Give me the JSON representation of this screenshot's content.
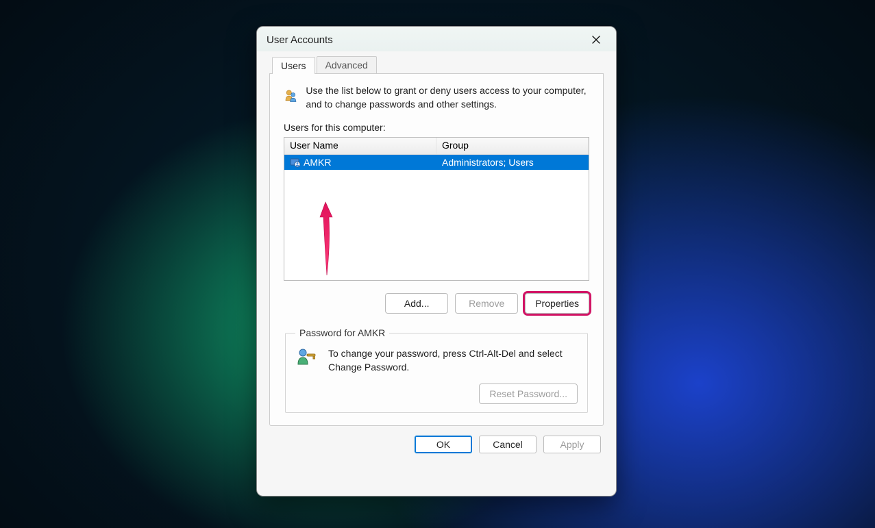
{
  "window": {
    "title": "User Accounts"
  },
  "tabs": {
    "users": "Users",
    "advanced": "Advanced"
  },
  "intro": "Use the list below to grant or deny users access to your computer, and to change passwords and other settings.",
  "users_label": "Users for this computer:",
  "columns": {
    "name": "User Name",
    "group": "Group"
  },
  "rows": [
    {
      "name": "AMKR",
      "group": "Administrators; Users",
      "selected": true
    }
  ],
  "buttons": {
    "add": "Add...",
    "remove": "Remove",
    "properties": "Properties"
  },
  "password_box": {
    "legend": "Password for AMKR",
    "text": "To change your password, press Ctrl-Alt-Del and select Change Password.",
    "reset": "Reset Password..."
  },
  "dialog": {
    "ok": "OK",
    "cancel": "Cancel",
    "apply": "Apply"
  }
}
